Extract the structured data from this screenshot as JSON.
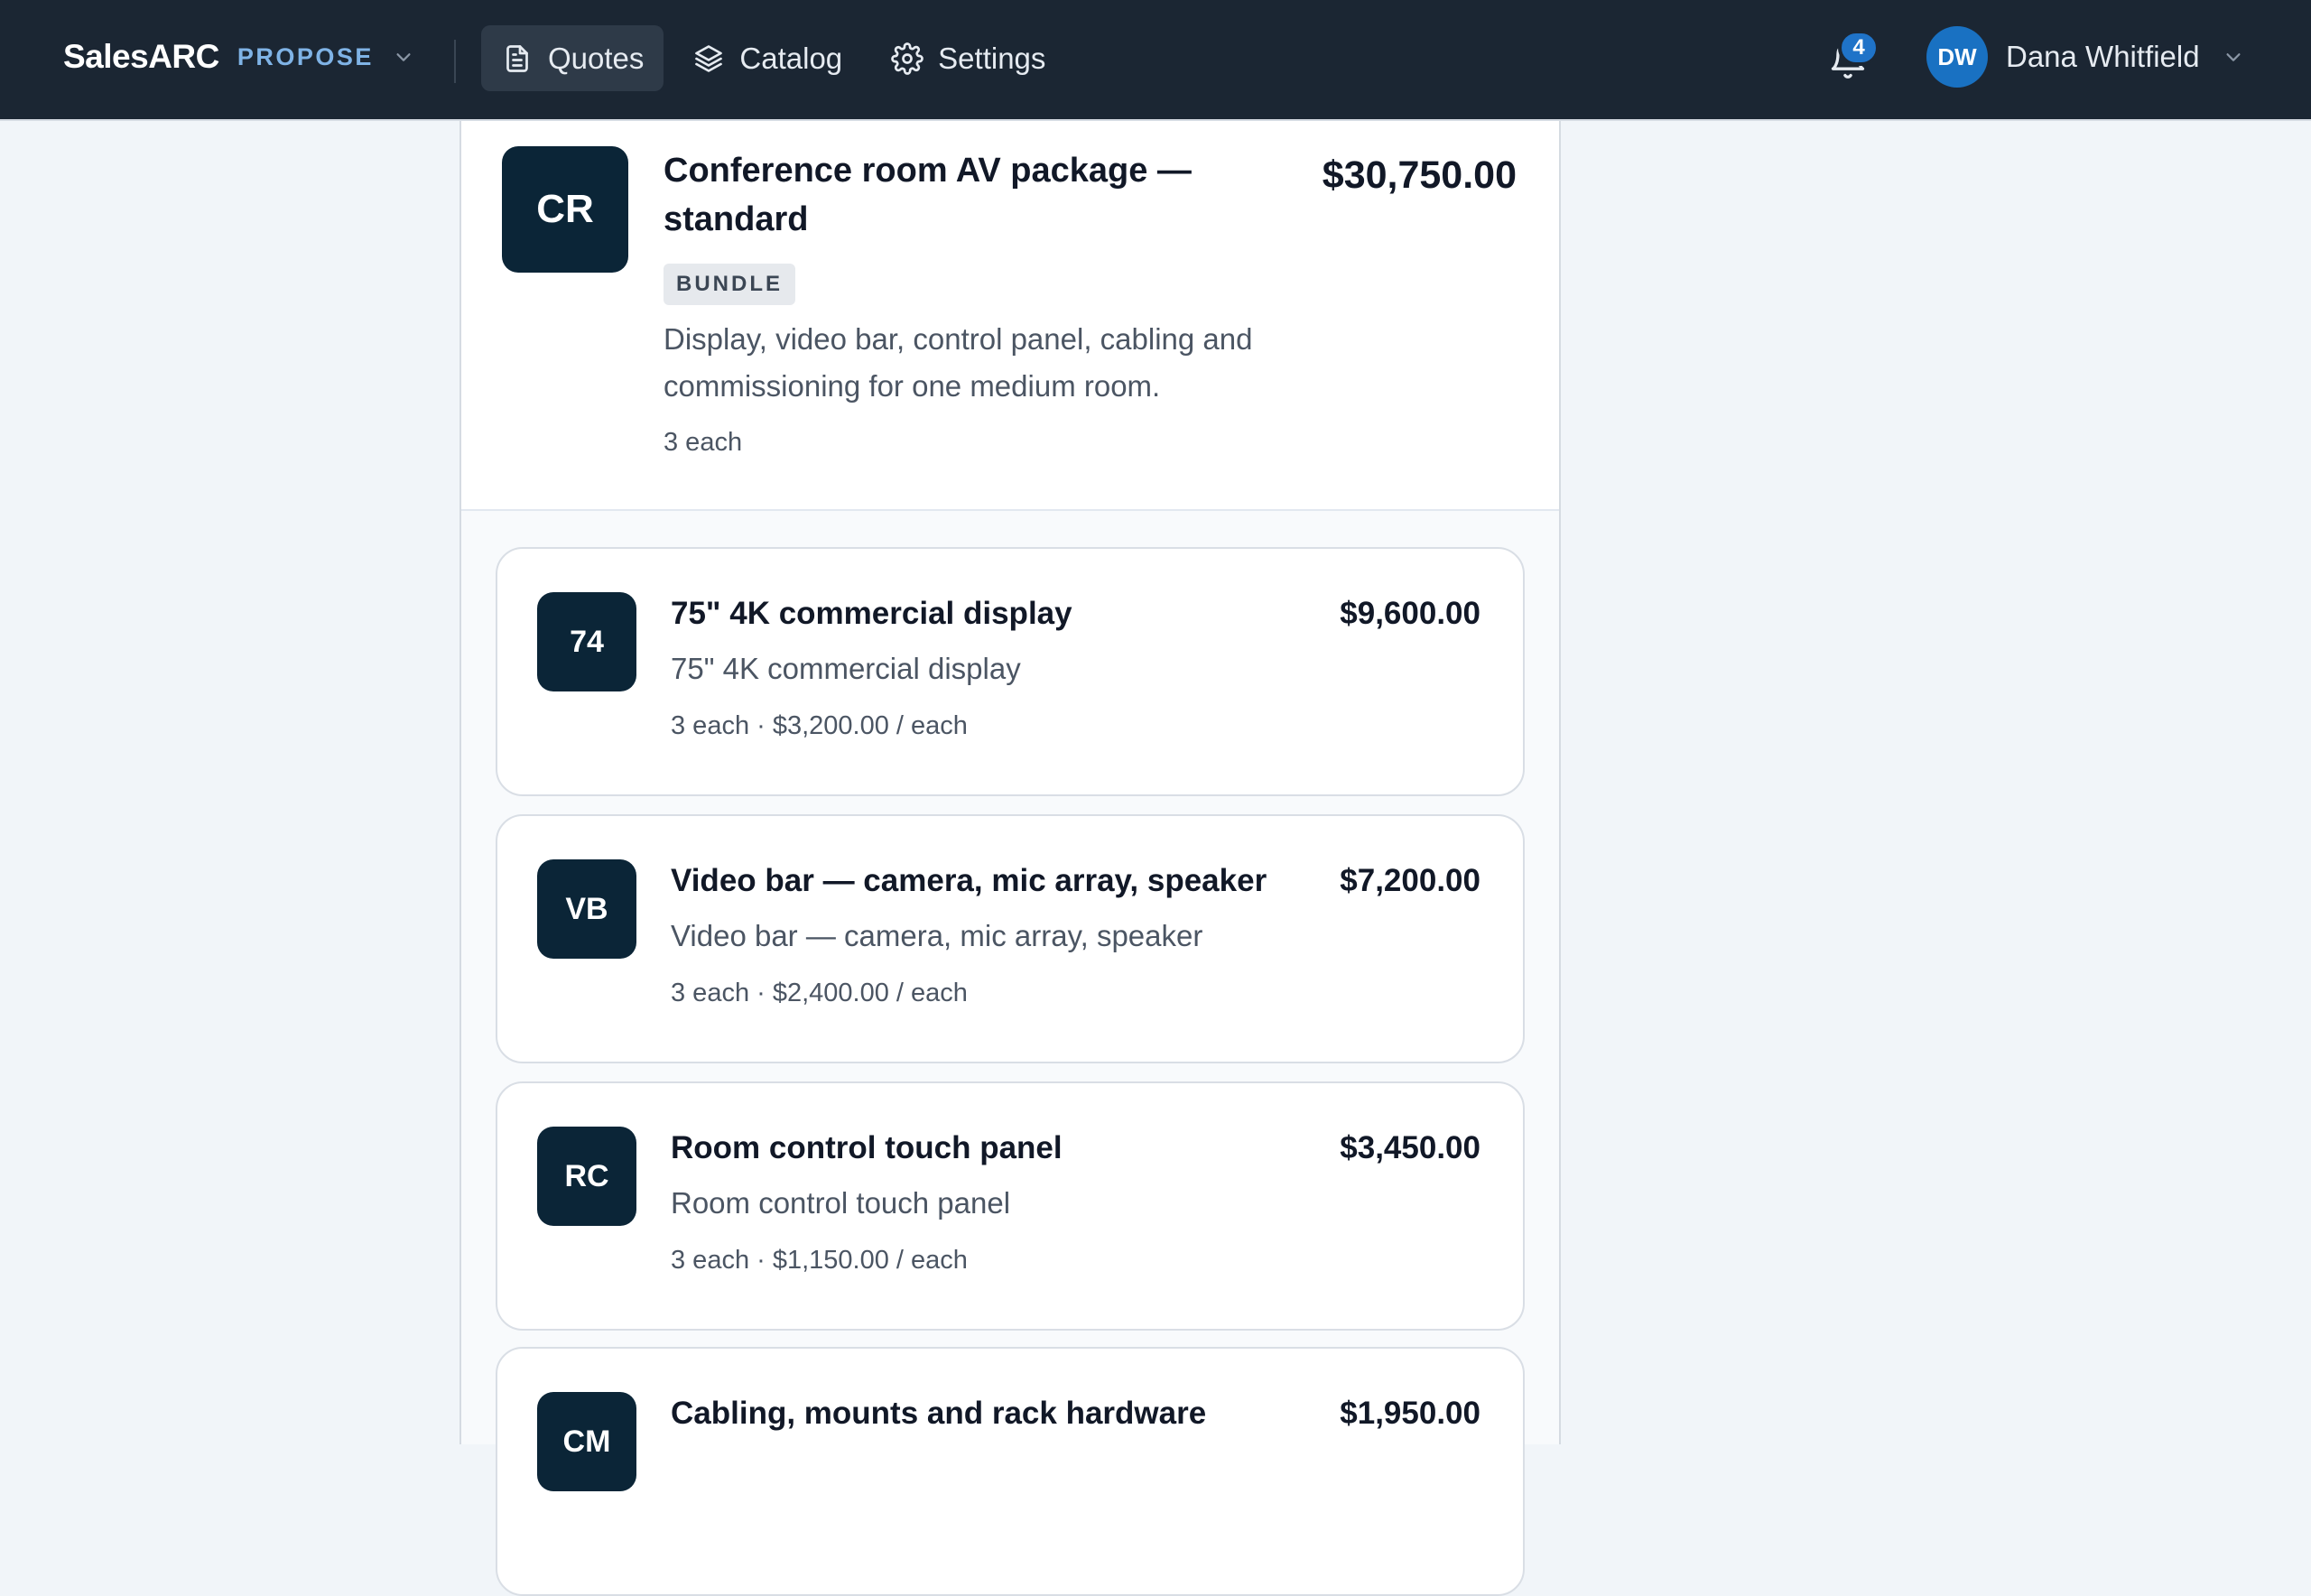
{
  "app": {
    "brand": "SalesARC",
    "product": "PROPOSE"
  },
  "nav": {
    "quotes": "Quotes",
    "catalog": "Catalog",
    "settings": "Settings"
  },
  "notifications": {
    "count": "4"
  },
  "user": {
    "initials": "DW",
    "name": "Dana Whitfield"
  },
  "bundle": {
    "initials": "CR",
    "title": "Conference room AV package — standard",
    "price": "$30,750.00",
    "badge": "BUNDLE",
    "description": "Display, video bar, control panel, cabling and commissioning for one medium room.",
    "quantity": "3 each"
  },
  "items": [
    {
      "initials": "74",
      "title": "75\" 4K commercial display",
      "price": "$9,600.00",
      "description": "75\" 4K commercial display",
      "meta": "3 each · $3,200.00 / each"
    },
    {
      "initials": "VB",
      "title": "Video bar — camera, mic array, speaker",
      "price": "$7,200.00",
      "description": "Video bar — camera, mic array, speaker",
      "meta": "3 each · $2,400.00 / each"
    },
    {
      "initials": "RC",
      "title": "Room control touch panel",
      "price": "$3,450.00",
      "description": "Room control touch panel",
      "meta": "3 each · $1,150.00 / each"
    },
    {
      "initials": "CM",
      "title": "Cabling, mounts and rack hardware",
      "price": "$1,950.00",
      "description": "",
      "meta": ""
    }
  ],
  "colors": {
    "topbar": "#1b2633",
    "accent": "#1f73c8",
    "tile": "#0b2537",
    "background": "#f1f5f9"
  }
}
